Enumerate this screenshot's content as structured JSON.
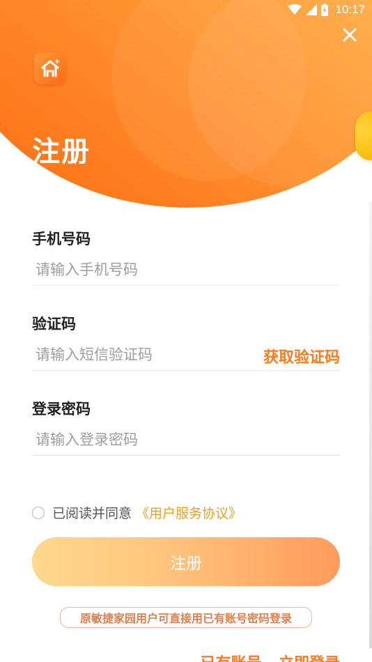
{
  "status_bar": {
    "time": "10:17"
  },
  "header": {
    "title": "注册"
  },
  "form": {
    "phone": {
      "label": "手机号码",
      "placeholder": "请输入手机号码",
      "value": ""
    },
    "code": {
      "label": "验证码",
      "placeholder": "请输入短信验证码",
      "value": "",
      "get_code_label": "获取验证码"
    },
    "password": {
      "label": "登录密码",
      "placeholder": "请输入登录密码",
      "value": ""
    }
  },
  "agreement": {
    "text": "已阅读并同意",
    "link": "《用户服务协议》",
    "checked": false
  },
  "submit": {
    "label": "注册"
  },
  "notice": {
    "text": "原敏捷家园用户可直接用已有账号密码登录"
  },
  "login_prompt": {
    "text": "已有账号",
    "link": "立即登录"
  },
  "colors": {
    "accent": "#ff7a1a",
    "header_gradient_start": "#ff6a12",
    "header_gradient_end": "#ffc04a",
    "link": "#f0a020"
  },
  "icons": {
    "close": "close-icon",
    "logo": "house-sparkle-icon",
    "wifi": "wifi-icon",
    "signal": "signal-icon",
    "battery": "battery-icon"
  }
}
